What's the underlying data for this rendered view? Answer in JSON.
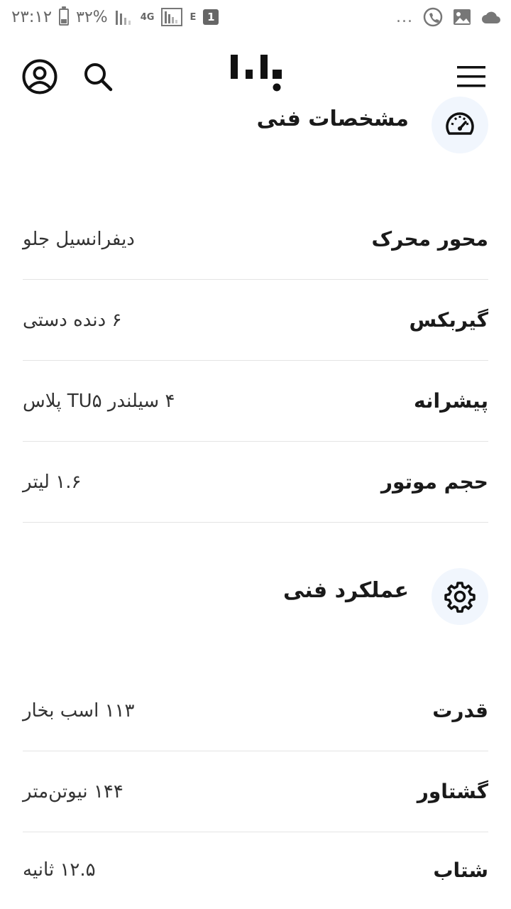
{
  "status_bar": {
    "time": "۲۳:۱۲",
    "battery": "۳۲%",
    "battery_level": 0.32,
    "network_4g": "4G",
    "network_e": "E",
    "notification_count": "1",
    "more": "..."
  },
  "header": {
    "logo_icon": "bama-logo-icon",
    "menu_icon": "hamburger-menu-icon",
    "search_icon": "search-icon",
    "profile_icon": "user-circle-icon"
  },
  "sections": [
    {
      "title": "مشخصات فنی",
      "icon": "speedometer-icon",
      "rows": [
        {
          "label": "محور محرک",
          "value": "دیفرانسیل جلو"
        },
        {
          "label": "گیربکس",
          "value": "۶ دنده دستی"
        },
        {
          "label": "پیشرانه",
          "value": "۴ سیلندر TU۵ پلاس"
        },
        {
          "label": "حجم موتور",
          "value": "۱.۶ لیتر"
        }
      ]
    },
    {
      "title": "عملکرد فنی",
      "icon": "gear-icon",
      "rows": [
        {
          "label": "قدرت",
          "value": "۱۱۳ اسب بخار"
        },
        {
          "label": "گشتاور",
          "value": "۱۴۴ نیوتن‌متر"
        },
        {
          "label": "شتاب",
          "value": "۱۲.۵ ثانیه"
        }
      ]
    }
  ],
  "colors": {
    "icon_circle_bg": "#f1f6fd",
    "divider": "#e4e4e4",
    "text": "#1a1a1a"
  }
}
